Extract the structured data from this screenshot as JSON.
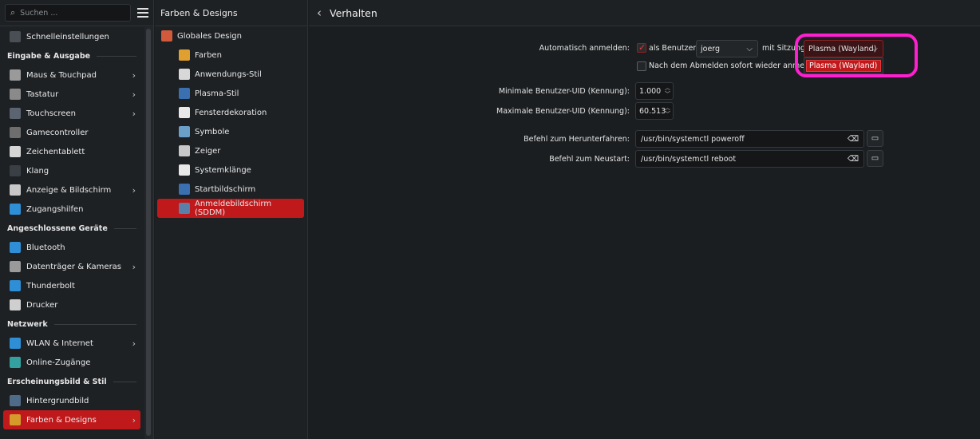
{
  "sidebar": {
    "search_placeholder": "Suchen ...",
    "items": [
      {
        "type": "item",
        "label": "Schnelleinstellungen",
        "icon": "quick-settings-icon",
        "color": "#4a4f55"
      },
      {
        "type": "section",
        "label": "Eingabe & Ausgabe"
      },
      {
        "type": "item",
        "label": "Maus & Touchpad",
        "icon": "mouse-icon",
        "color": "#9a9a9a",
        "chevron": true
      },
      {
        "type": "item",
        "label": "Tastatur",
        "icon": "keyboard-icon",
        "color": "#8a8a8a",
        "chevron": true
      },
      {
        "type": "item",
        "label": "Touchscreen",
        "icon": "touchscreen-icon",
        "color": "#5b6470",
        "chevron": true
      },
      {
        "type": "item",
        "label": "Gamecontroller",
        "icon": "gamepad-icon",
        "color": "#6e6e6e"
      },
      {
        "type": "item",
        "label": "Zeichentablett",
        "icon": "tablet-icon",
        "color": "#d6d6d6"
      },
      {
        "type": "item",
        "label": "Klang",
        "icon": "speaker-icon",
        "color": "#3a3f46"
      },
      {
        "type": "item",
        "label": "Anzeige & Bildschirm",
        "icon": "display-icon",
        "color": "#c8c8c8",
        "chevron": true
      },
      {
        "type": "item",
        "label": "Zugangshilfen",
        "icon": "accessibility-icon",
        "color": "#2f8fd6"
      },
      {
        "type": "section",
        "label": "Angeschlossene Geräte"
      },
      {
        "type": "item",
        "label": "Bluetooth",
        "icon": "bluetooth-icon",
        "color": "#2f8fd6"
      },
      {
        "type": "item",
        "label": "Datenträger & Kameras",
        "icon": "drive-icon",
        "color": "#9a9a9a",
        "chevron": true
      },
      {
        "type": "item",
        "label": "Thunderbolt",
        "icon": "thunderbolt-icon",
        "color": "#2f8fd6"
      },
      {
        "type": "item",
        "label": "Drucker",
        "icon": "printer-icon",
        "color": "#cfcfcf"
      },
      {
        "type": "section",
        "label": "Netzwerk"
      },
      {
        "type": "item",
        "label": "WLAN & Internet",
        "icon": "network-icon",
        "color": "#2f8fd6",
        "chevron": true
      },
      {
        "type": "item",
        "label": "Online-Zugänge",
        "icon": "online-accounts-icon",
        "color": "#35a0a0"
      },
      {
        "type": "section",
        "label": "Erscheinungsbild & Stil"
      },
      {
        "type": "item",
        "label": "Hintergrundbild",
        "icon": "wallpaper-icon",
        "color": "#4f6b88"
      },
      {
        "type": "item",
        "label": "Farben & Designs",
        "icon": "palette-icon",
        "color": "#d69a2b",
        "chevron": true,
        "active": true
      }
    ]
  },
  "middle": {
    "title": "Farben & Designs",
    "items": [
      {
        "label": "Globales Design",
        "icon": "global-theme-icon",
        "color": "#d05a3b",
        "top": true
      },
      {
        "label": "Farben",
        "icon": "colors-icon",
        "color": "#e0a030"
      },
      {
        "label": "Anwendungs-Stil",
        "icon": "app-style-icon",
        "color": "#d8d8d8"
      },
      {
        "label": "Plasma-Stil",
        "icon": "plasma-style-icon",
        "color": "#3a6fb0"
      },
      {
        "label": "Fensterdekoration",
        "icon": "window-decoration-icon",
        "color": "#e8e8e8"
      },
      {
        "label": "Symbole",
        "icon": "icons-icon",
        "color": "#6aa0c8"
      },
      {
        "label": "Zeiger",
        "icon": "cursor-icon",
        "color": "#c8c8c8"
      },
      {
        "label": "Systemklänge",
        "icon": "music-note-icon",
        "color": "#e8e8e8"
      },
      {
        "label": "Startbildschirm",
        "icon": "splash-icon",
        "color": "#3a6fb0"
      },
      {
        "label": "Anmeldebildschirm (SDDM)",
        "icon": "login-screen-icon",
        "color": "#5a7fa8",
        "active": true
      }
    ]
  },
  "content": {
    "title": "Verhalten",
    "autologin_label": "Automatisch anmelden:",
    "as_user_label": "als Benutzer:",
    "user_value": "joerg",
    "with_session_label": "mit Sitzung:",
    "session_value": "Plasma (Wayland)",
    "session_dropdown_option": "Plasma (Wayland)",
    "relogin_label": "Nach dem Abmelden sofort wieder anmelden",
    "min_uid_label": "Minimale Benutzer-UID (Kennung):",
    "min_uid_value": "1.000",
    "max_uid_label": "Maximale Benutzer-UID (Kennung):",
    "max_uid_value": "60.513",
    "shutdown_label": "Befehl zum Herunterfahren:",
    "shutdown_value": "/usr/bin/systemctl poweroff",
    "reboot_label": "Befehl zum Neustart:",
    "reboot_value": "/usr/bin/systemctl reboot",
    "accent_color": "#c0191c",
    "highlight_color": "#ff1fd0"
  }
}
